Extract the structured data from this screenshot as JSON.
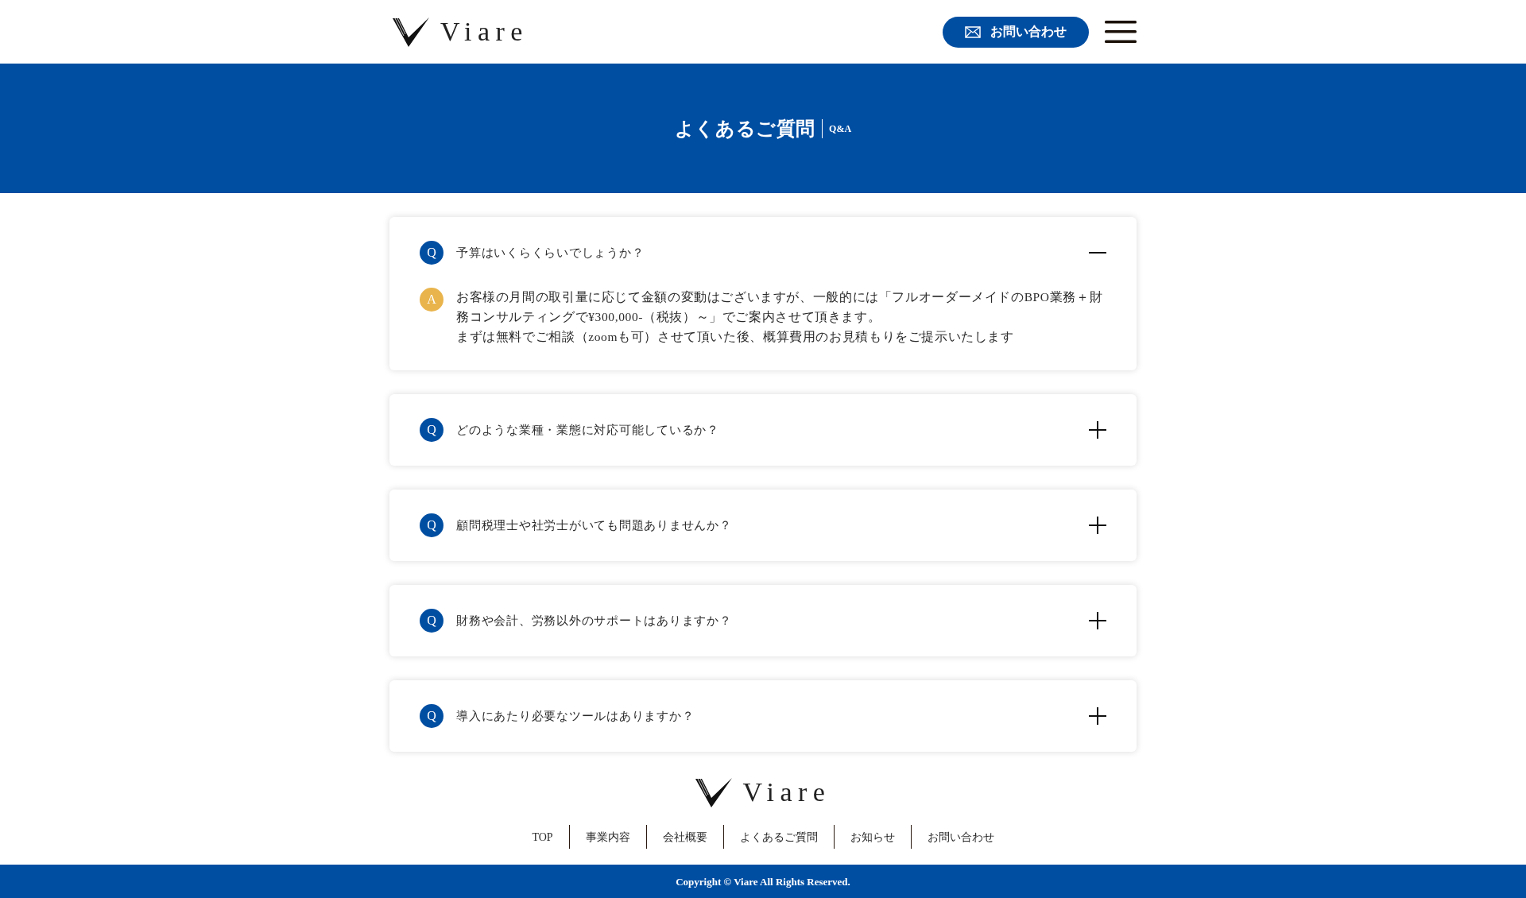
{
  "header": {
    "logo": "Viare",
    "contact_button": "お問い合わせ"
  },
  "banner": {
    "title": "よくあるご質問",
    "subtitle": "Q&A"
  },
  "faq": [
    {
      "q_mark": "Q",
      "question": "予算はいくらくらいでしょうか？",
      "expanded": true,
      "a_mark": "A",
      "answer_lines": [
        "お客様の月間の取引量に応じて金額の変動はございますが、一般的には「フルオーダーメイドのBPO業務＋財務コンサルティングで¥300,000-（税抜）～」でご案内させて頂きます。",
        "まずは無料でご相談（zoomも可）させて頂いた後、概算費用のお見積もりをご提示いたします"
      ]
    },
    {
      "q_mark": "Q",
      "question": "どのような業種・業態に対応可能しているか？",
      "expanded": false
    },
    {
      "q_mark": "Q",
      "question": "顧問税理士や社労士がいても問題ありませんか？",
      "expanded": false
    },
    {
      "q_mark": "Q",
      "question": "財務や会計、労務以外のサポートはありますか？",
      "expanded": false
    },
    {
      "q_mark": "Q",
      "question": "導入にあたり必要なツールはありますか？",
      "expanded": false
    }
  ],
  "footer": {
    "logo": "Viare",
    "nav": [
      "TOP",
      "事業内容",
      "会社概要",
      "よくあるご質問",
      "お知らせ",
      "お問い合わせ"
    ],
    "copyright": "Copyright © Viare All Rights Reserved."
  }
}
